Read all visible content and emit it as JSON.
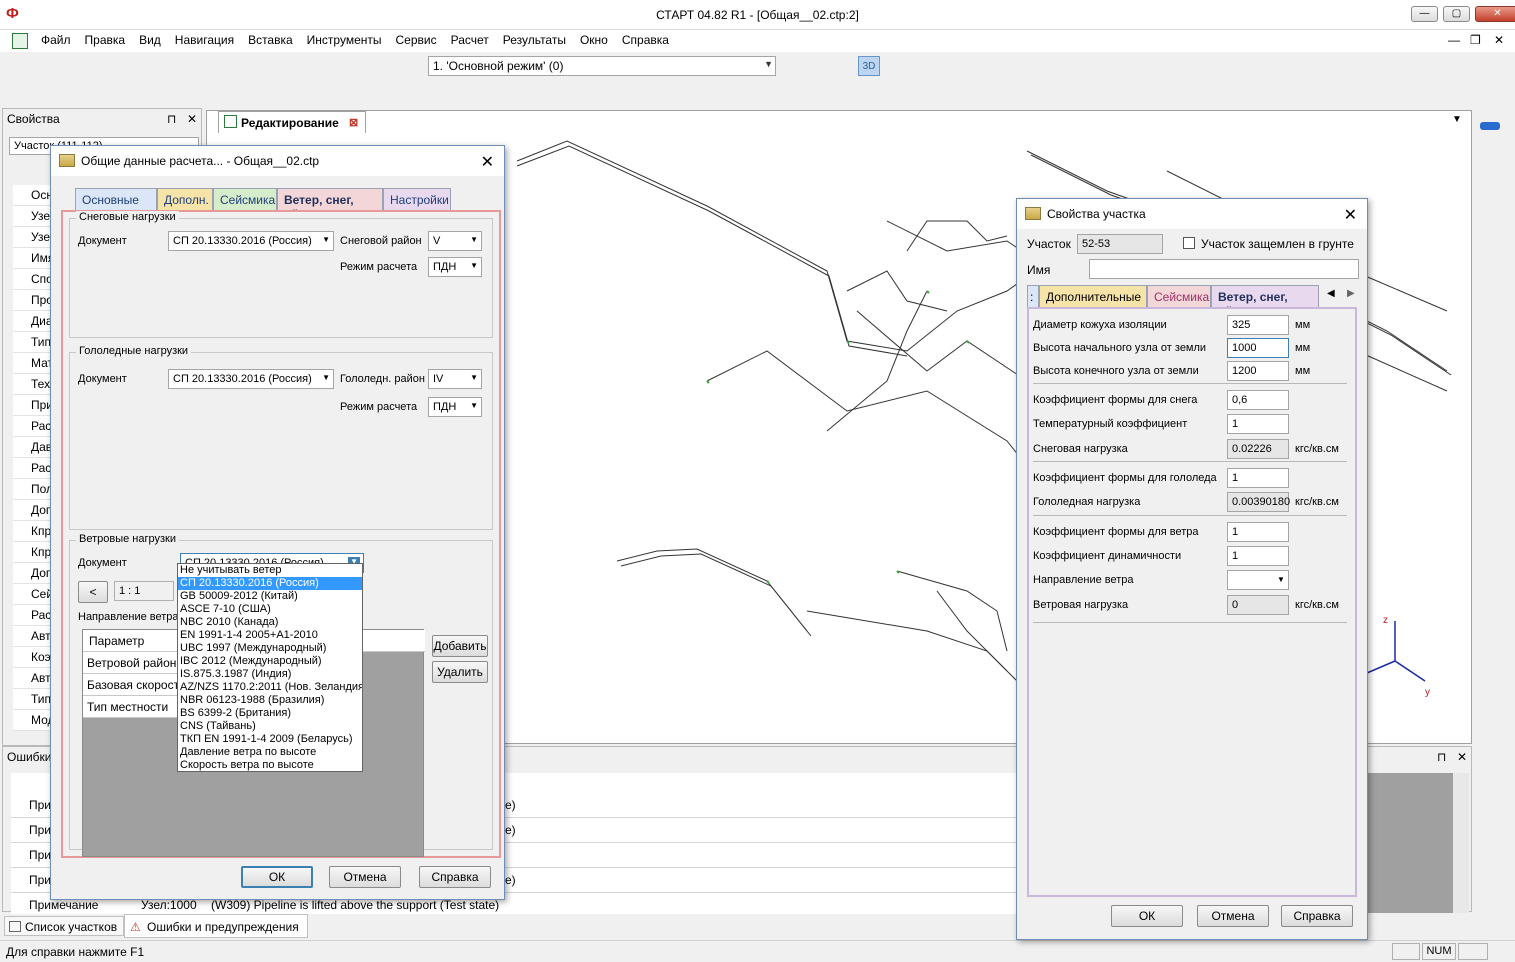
{
  "window": {
    "title": "СТАРТ 04.82 R1 - [Общая__02.ctp:2]",
    "min": "—",
    "max": "▢",
    "close": "✕"
  },
  "menu": [
    "Файл",
    "Правка",
    "Вид",
    "Навигация",
    "Вставка",
    "Инструменты",
    "Сервис",
    "Расчет",
    "Результаты",
    "Окно",
    "Справка"
  ],
  "toolbar": {
    "mode_combo": "1. 'Основной режим' (0)",
    "btn_3d": "3D"
  },
  "props_panel": {
    "title": "Свойства",
    "filter": "Участок (111-112)",
    "rows": [
      "Осн",
      "Узе",
      "Узе",
      "Имя",
      "Спо",
      "Про",
      "Диа",
      "Тип",
      "Мат",
      "Тех",
      "При",
      "Рас",
      "Дав",
      "Рас",
      "Пол",
      "Доп",
      "Кпр",
      "Кпр",
      "Доп",
      "Сей",
      "Рас",
      "Авт",
      "Коэ",
      "Авт",
      "Тип",
      "Мод"
    ]
  },
  "draw_tab": "Редактирование",
  "axes": {
    "z": "z",
    "y": "y"
  },
  "errors_panel": {
    "title": "Ошибки",
    "rows": [
      {
        "type": "При",
        "text": "е)"
      },
      {
        "type": "При",
        "text": "е)"
      },
      {
        "type": "При",
        "text": ""
      },
      {
        "type": "При",
        "text": "е)"
      },
      {
        "type": "Примечание",
        "node": "Узел:1000",
        "text": "(W309) Pipeline is lifted above the support (Test state)"
      }
    ]
  },
  "bottom_tabs": [
    "Список участков",
    "Ошибки и предупреждения"
  ],
  "status": {
    "help": "Для справки нажмите F1",
    "num": "NUM"
  },
  "dlg1": {
    "title": "Общие данные расчета... - Общая__02.ctp",
    "tabs": [
      "Основные",
      "Дополн.",
      "Сейсмика",
      "Ветер, снег, лёд",
      "Настройки"
    ],
    "snow": {
      "group": "Снеговые нагрузки",
      "doc_label": "Документ",
      "doc_value": "СП 20.13330.2016 (Россия)",
      "region_label": "Снеговой район",
      "region_value": "V",
      "mode_label": "Режим расчета",
      "mode_value": "ПДН"
    },
    "ice": {
      "group": "Гололедные нагрузки",
      "doc_label": "Документ",
      "doc_value": "СП 20.13330.2016 (Россия)",
      "region_label": "Гололедн. район",
      "region_value": "IV",
      "mode_label": "Режим расчета",
      "mode_value": "ПДН"
    },
    "wind": {
      "group": "Ветровые нагрузки",
      "doc_label": "Документ",
      "doc_value": "СП 20.13330.2016 (Россия)",
      "prev_btn": "<",
      "scale": "1 : 1",
      "dir_label": "Направление ветра",
      "table_header": "Параметр",
      "table_rows": [
        "Ветровой район",
        "Базовая скорость",
        "Тип местности"
      ],
      "add_btn": "Добавить",
      "del_btn": "Удалить"
    },
    "dropdown_options": [
      "Не учитывать ветер",
      "СП 20.13330.2016 (Россия)",
      "GB 50009-2012 (Китай)",
      "ASCE 7-10 (США)",
      "NBC 2010 (Канада)",
      "EN 1991-1-4 2005+A1-2010",
      "UBC 1997 (Международный)",
      "IBC 2012 (Международный)",
      "IS.875.3.1987 (Индия)",
      "AZ/NZS 1170.2:2011 (Нов. Зеландия",
      "NBR 06123-1988 (Бразилия)",
      "BS 6399-2 (Британия)",
      "CNS (Тайвань)",
      "ТКП EN 1991-1-4 2009 (Беларусь)",
      "Давление ветра по высоте",
      "Скорость ветра по высоте"
    ],
    "ok": "ОК",
    "cancel": "Отмена",
    "help": "Справка"
  },
  "dlg2": {
    "title": "Свойства участка",
    "segment_label": "Участок",
    "segment_value": "52-53",
    "pinned_label": "Участок защемлен в грунте",
    "name_label": "Имя",
    "name_value": "",
    "tabs": [
      ":",
      "Дополнительные",
      "Сейсмика",
      "Ветер, снег, лёд"
    ],
    "fields": [
      {
        "label": "Диаметр кожуха изоляции",
        "value": "325",
        "unit": "мм",
        "ro": false
      },
      {
        "label": "Высота начального узла от земли",
        "value": "1000",
        "unit": "мм",
        "ro": false
      },
      {
        "label": "Высота конечного узла от земли",
        "value": "1200",
        "unit": "мм",
        "ro": false
      },
      {
        "label": "Коэффициент формы для снега",
        "value": "0,6",
        "unit": "",
        "ro": false
      },
      {
        "label": "Температурный коэффициент",
        "value": "1",
        "unit": "",
        "ro": false
      },
      {
        "label": "Снеговая нагрузка",
        "value": "0.02226",
        "unit": "кгс/кв.см",
        "ro": true
      },
      {
        "label": "Коэффициент формы для гололеда",
        "value": "1",
        "unit": "",
        "ro": false
      },
      {
        "label": "Гололедная нагрузка",
        "value": "0.00390180",
        "unit": "кгс/кв.см",
        "ro": true
      },
      {
        "label": "Коэффициент формы для ветра",
        "value": "1",
        "unit": "",
        "ro": false
      },
      {
        "label": "Коэффициент динамичности",
        "value": "1",
        "unit": "",
        "ro": false
      },
      {
        "label": "Направление ветра",
        "value": "",
        "unit": "",
        "ro": false
      },
      {
        "label": "Ветровая нагрузка",
        "value": "0",
        "unit": "кгс/кв.см",
        "ro": true
      }
    ],
    "ok": "ОК",
    "cancel": "Отмена",
    "help": "Справка"
  }
}
